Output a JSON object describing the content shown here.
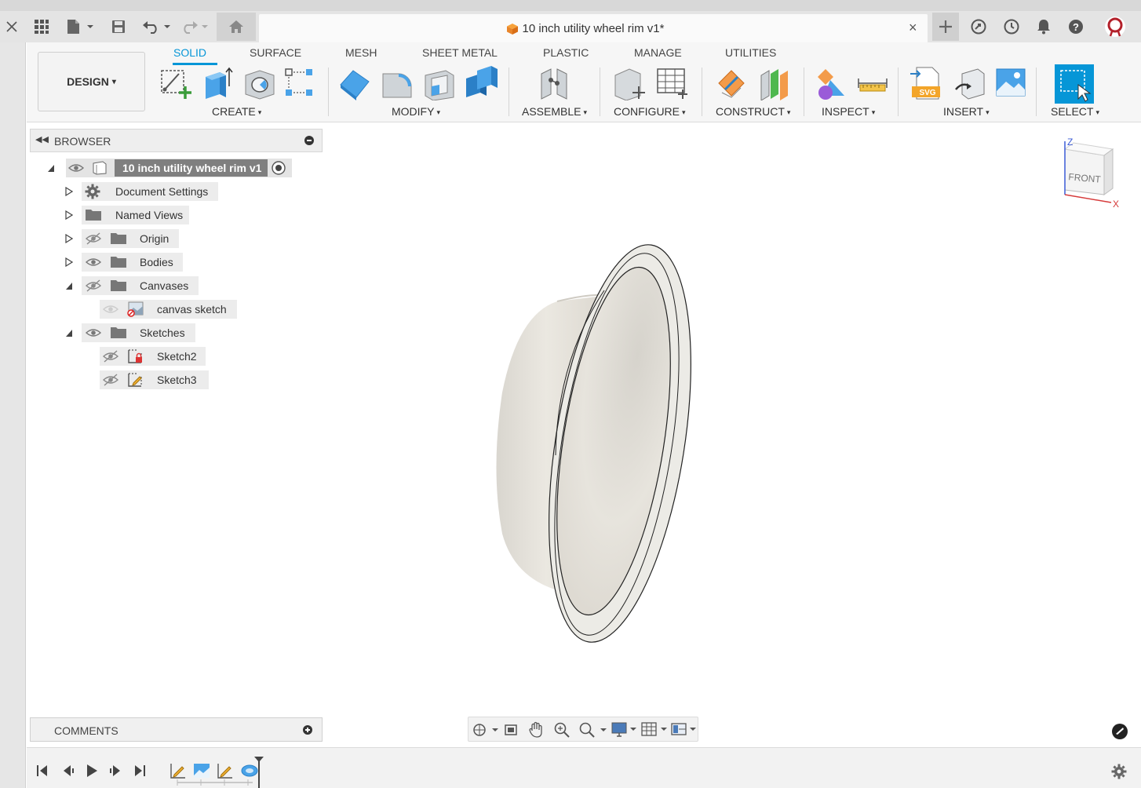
{
  "app": {
    "document_title": "10 inch utility wheel rim v1*",
    "close_glyph": "×"
  },
  "toolbar": {
    "workspace_label": "DESIGN",
    "tabs": [
      "SOLID",
      "SURFACE",
      "MESH",
      "SHEET METAL",
      "PLASTIC",
      "MANAGE",
      "UTILITIES"
    ],
    "active_tab": "SOLID",
    "groups": [
      "CREATE",
      "MODIFY",
      "ASSEMBLE",
      "CONFIGURE",
      "CONSTRUCT",
      "INSPECT",
      "INSERT",
      "SELECT"
    ],
    "caret": "▾",
    "accent_color": "#0696d7"
  },
  "browser": {
    "title": "BROWSER",
    "root": "10 inch utility wheel rim v1",
    "items": [
      {
        "label": "Document Settings",
        "icon": "gear-icon"
      },
      {
        "label": "Named Views",
        "icon": "folder-icon"
      },
      {
        "label": "Origin",
        "icon": "folder-icon",
        "visible": false
      },
      {
        "label": "Bodies",
        "icon": "folder-icon",
        "visible": true
      },
      {
        "label": "Canvases",
        "icon": "folder-icon",
        "visible": false,
        "expanded": true
      },
      {
        "label": "canvas sketch",
        "icon": "canvas-image-icon"
      },
      {
        "label": "Sketches",
        "icon": "folder-icon",
        "visible": true,
        "expanded": true
      },
      {
        "label": "Sketch2",
        "icon": "sketch-locked-icon",
        "visible": false
      },
      {
        "label": "Sketch3",
        "icon": "sketch-edit-icon",
        "visible": false
      }
    ]
  },
  "viewcube": {
    "face": "FRONT",
    "axis_z": "Z",
    "axis_x": "X"
  },
  "comments": {
    "title": "COMMENTS"
  }
}
